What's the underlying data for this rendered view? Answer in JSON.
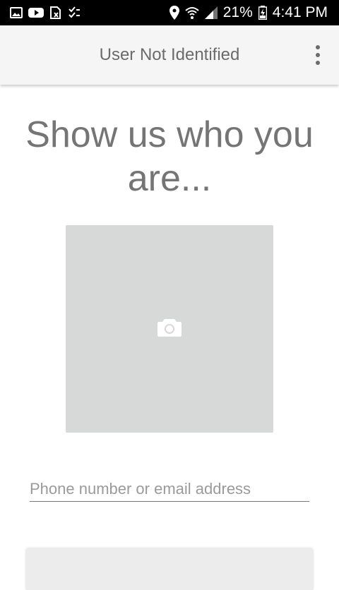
{
  "status_bar": {
    "battery": "21%",
    "time": "4:41 PM",
    "icons": [
      "gallery-icon",
      "youtube-icon",
      "sim-x-icon",
      "checklist-icon",
      "location-icon",
      "wifi-icon",
      "signal-icon",
      "battery-icon"
    ]
  },
  "app_bar": {
    "title": "User Not Identified",
    "menu_icon": "more-vert-icon"
  },
  "main": {
    "heading": "Show us who you are...",
    "photo_icon": "camera-icon",
    "contact_input": {
      "value": "",
      "placeholder": "Phone number or email address"
    }
  },
  "colors": {
    "status_bar_bg": "#000000",
    "app_bar_bg": "#f5f5f5",
    "text_gray": "#757575",
    "photo_bg": "#d7d8d8"
  }
}
